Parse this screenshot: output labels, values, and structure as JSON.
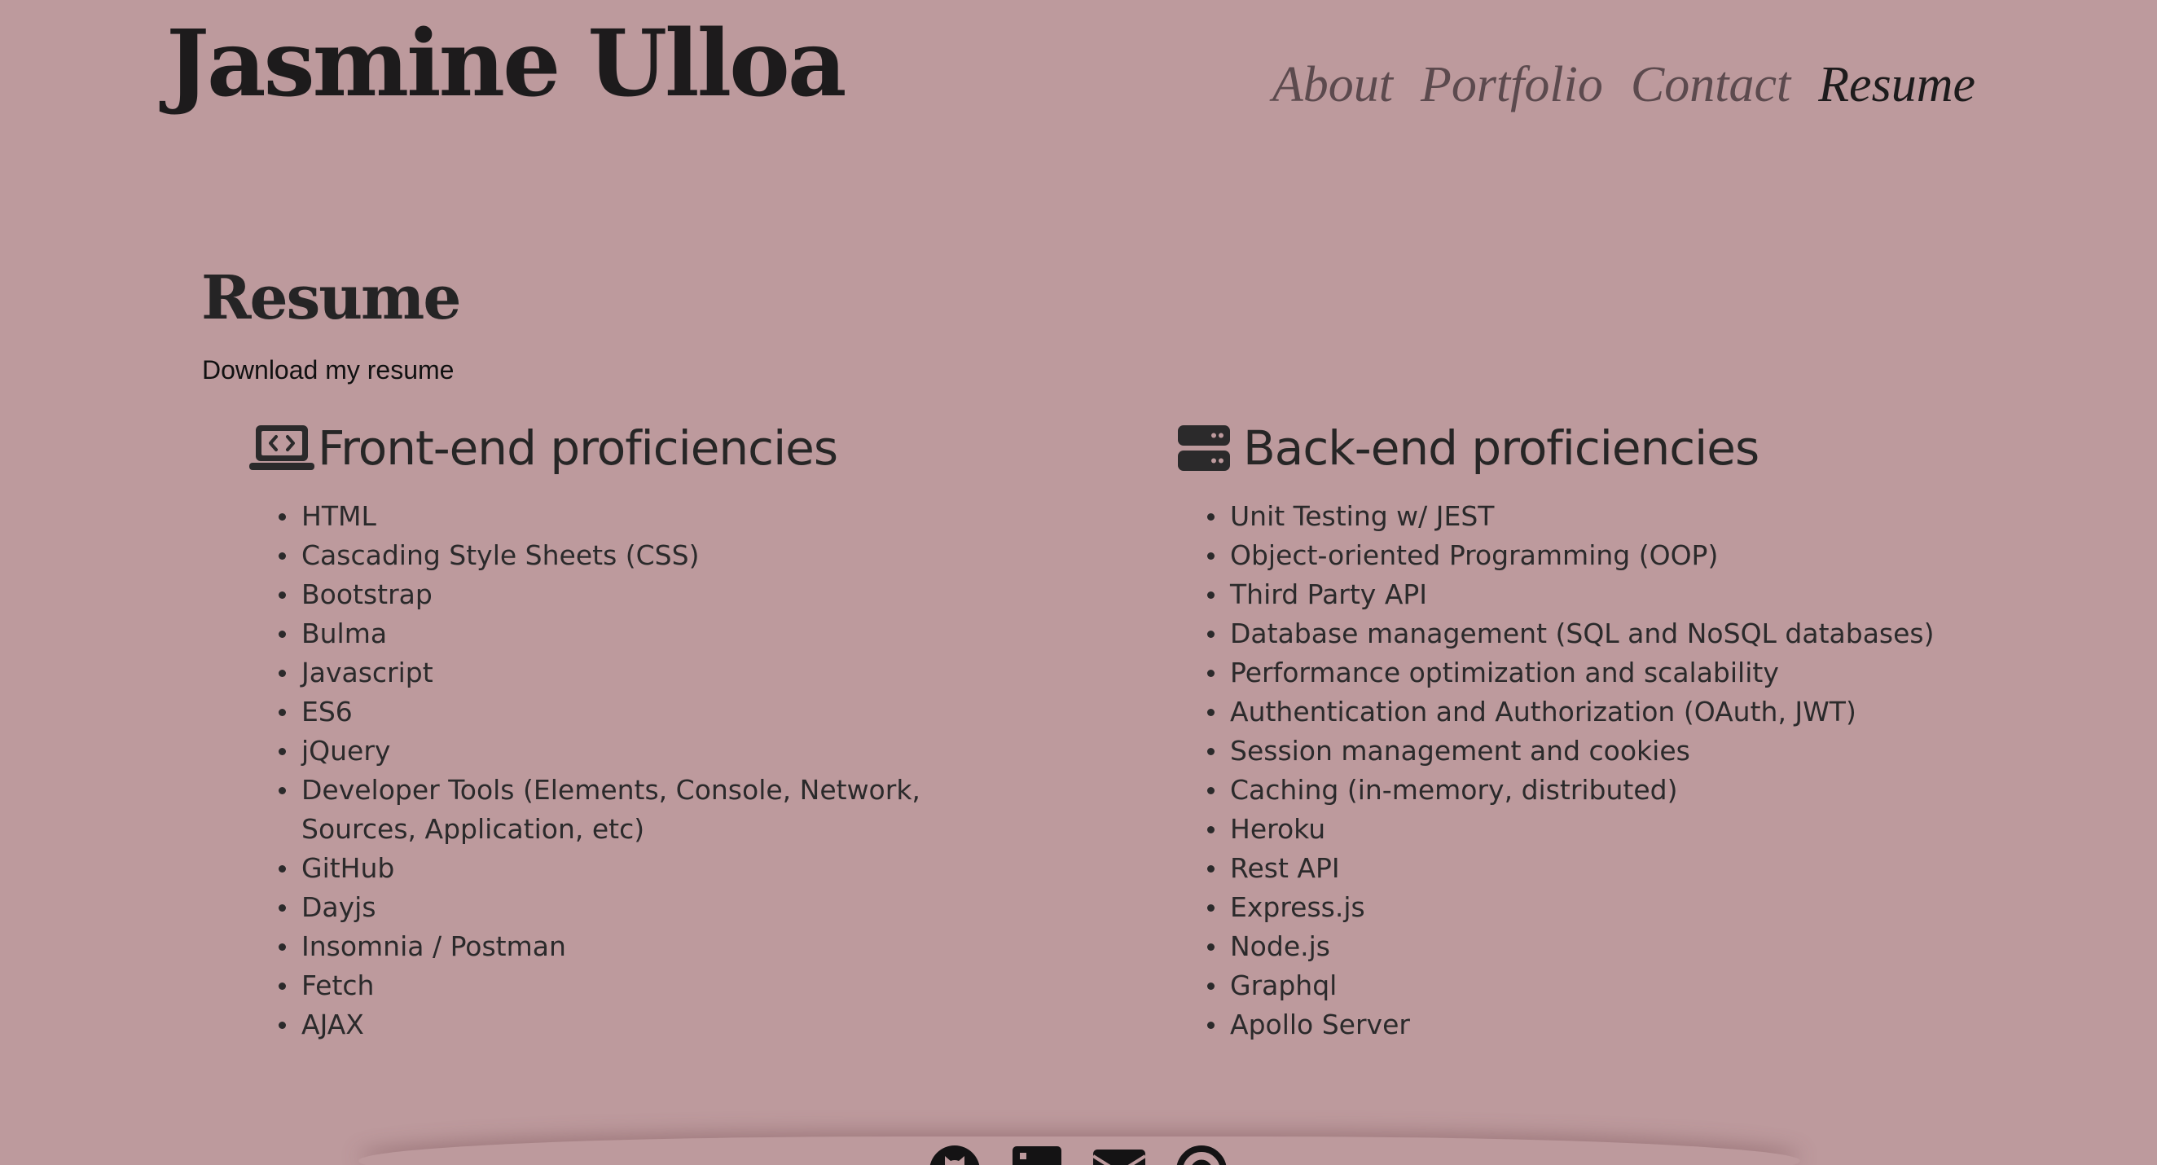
{
  "header": {
    "title": "Jasmine Ulloa",
    "nav": [
      {
        "label": "About",
        "active": false
      },
      {
        "label": "Portfolio",
        "active": false
      },
      {
        "label": "Contact",
        "active": false
      },
      {
        "label": "Resume",
        "active": true
      }
    ]
  },
  "main": {
    "heading": "Resume",
    "download_label": "Download my resume",
    "frontend": {
      "icon": "laptop-code-icon",
      "heading": "Front-end proficiencies",
      "items": [
        "HTML",
        "Cascading Style Sheets (CSS)",
        "Bootstrap",
        "Bulma",
        "Javascript",
        "ES6",
        "jQuery",
        "Developer Tools (Elements, Console, Network, Sources, Application, etc)",
        "GitHub",
        "Dayjs",
        "Insomnia / Postman",
        "Fetch",
        "AJAX"
      ]
    },
    "backend": {
      "icon": "server-icon",
      "heading": "Back-end proficiencies",
      "items": [
        "Unit Testing w/ JEST",
        "Object-oriented Programming (OOP)",
        "Third Party API",
        "Database management (SQL and NoSQL databases)",
        "Performance optimization and scalability",
        "Authentication and Authorization (OAuth, JWT)",
        "Session management and cookies",
        "Caching (in-memory, distributed)",
        "Heroku",
        "Rest API",
        "Express.js",
        "Node.js",
        "Graphql",
        "Apollo Server"
      ]
    }
  },
  "footer": {
    "icons": [
      "github-icon",
      "linkedin-icon",
      "envelope-icon",
      "at-sign-icon"
    ]
  },
  "colors": {
    "background": "#bd9a9d",
    "text": "#2b2a2b",
    "title": "#1d1b1c",
    "nav_inactive": "#5c4a4e"
  }
}
